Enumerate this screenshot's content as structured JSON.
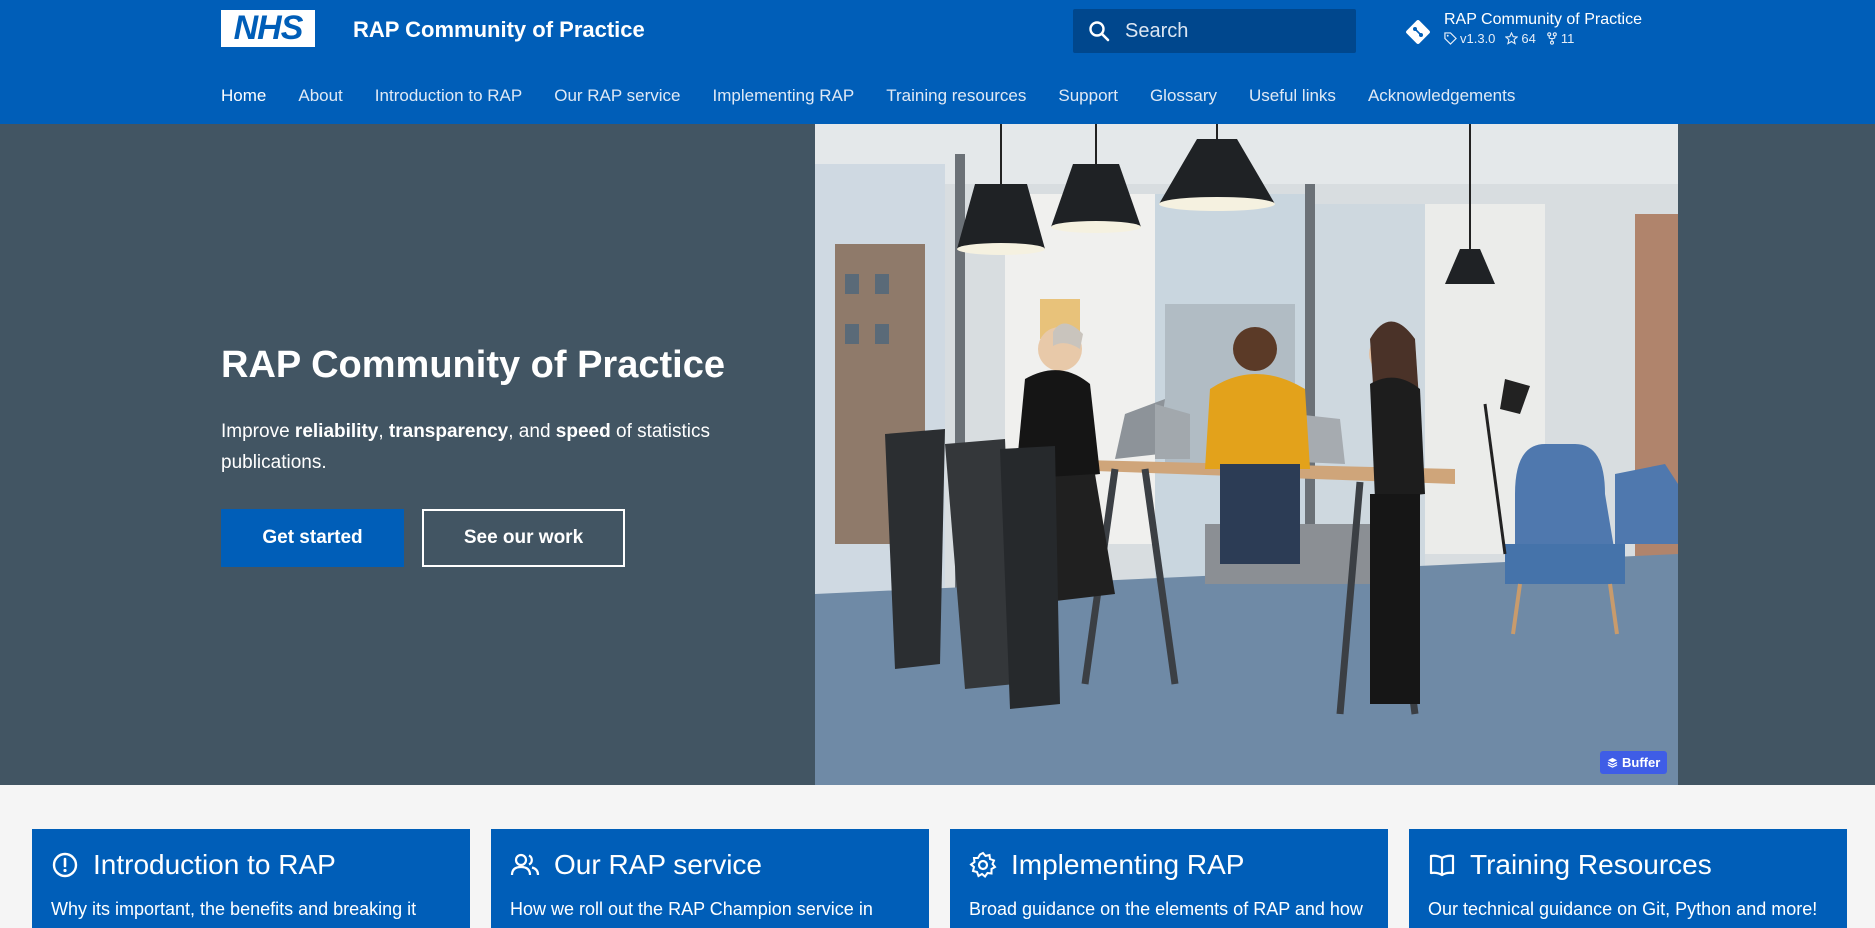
{
  "header": {
    "logo_text": "NHS",
    "site_title": "RAP Community of Practice",
    "search_placeholder": "Search",
    "repo": {
      "name": "RAP Community of Practice",
      "version": "v1.3.0",
      "stars": "64",
      "forks": "11"
    }
  },
  "nav": {
    "items": [
      "Home",
      "About",
      "Introduction to RAP",
      "Our RAP service",
      "Implementing RAP",
      "Training resources",
      "Support",
      "Glossary",
      "Useful links",
      "Acknowledgements"
    ],
    "active": "Home"
  },
  "hero": {
    "title": "RAP Community of Practice",
    "sub_1": "Improve ",
    "sub_b1": "reliability",
    "sub_2": ", ",
    "sub_b2": "transparency",
    "sub_3": ", and ",
    "sub_b3": "speed",
    "sub_4": " of statistics publications.",
    "primary_button": "Get started",
    "secondary_button": "See our work",
    "badge": "Buffer"
  },
  "cards": [
    {
      "title": "Introduction to RAP",
      "text": "Why its important, the benefits and breaking it",
      "icon": "alert-circle-icon"
    },
    {
      "title": "Our RAP service",
      "text": "How we roll out the RAP Champion service in",
      "icon": "people-icon"
    },
    {
      "title": "Implementing RAP",
      "text": "Broad guidance on the elements of RAP and how",
      "icon": "gear-icon"
    },
    {
      "title": "Training Resources",
      "text": "Our technical guidance on Git, Python and more!",
      "icon": "book-icon"
    }
  ],
  "colors": {
    "brand_blue": "#005eb8",
    "hero_bg": "#425563",
    "search_bg": "#00478d"
  }
}
